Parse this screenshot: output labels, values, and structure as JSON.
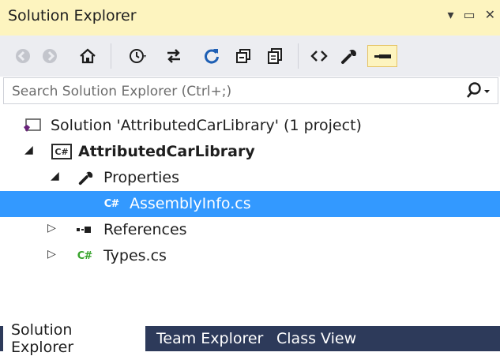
{
  "window": {
    "title": "Solution Explorer",
    "controls": [
      "dropdown-icon",
      "maximize-icon",
      "close-icon"
    ]
  },
  "toolbar": {
    "buttons": [
      {
        "name": "back-icon",
        "glyph": "⊝"
      },
      {
        "name": "forward-icon",
        "glyph": "⊝"
      },
      {
        "name": "home-icon",
        "glyph": "⌂"
      },
      {
        "name": "pending-changes-icon",
        "glyph": "⏲"
      },
      {
        "name": "sync-icon",
        "glyph": "⇆"
      },
      {
        "name": "refresh-icon",
        "glyph": "↻"
      },
      {
        "name": "collapse-all-icon",
        "glyph": "⧉"
      },
      {
        "name": "show-all-files-icon",
        "glyph": "⎘"
      },
      {
        "name": "view-code-icon",
        "glyph": "<>"
      },
      {
        "name": "properties-icon",
        "glyph": "🔧"
      },
      {
        "name": "preview-selected-icon",
        "glyph": "▬"
      }
    ],
    "dropdown_glyph": "▾"
  },
  "search": {
    "placeholder": "Search Solution Explorer (Ctrl+;)",
    "icon": "search-icon",
    "icon_glyph": "⚲",
    "dropdown_glyph": "▾"
  },
  "tree": {
    "solution_label": "Solution 'AttributedCarLibrary' (1 project)",
    "project_label": "AttributedCarLibrary",
    "project_badge": "C#",
    "properties_label": "Properties",
    "assemblyinfo_label": "AssemblyInfo.cs",
    "references_label": "References",
    "types_label": "Types.cs",
    "cs_badge": "C#",
    "expanded_glyph": "◢",
    "collapsed_glyph": "▷",
    "wrench_glyph": "🔧",
    "references_glyph": "▪▪"
  },
  "tabs": [
    {
      "label": "Solution Explorer",
      "active": true
    },
    {
      "label": "Team Explorer",
      "active": false
    },
    {
      "label": "Class View",
      "active": false
    }
  ],
  "colors": {
    "title_bar": "#fdf4bf",
    "selection": "#3399ff",
    "tab_bar": "#2d3a5a",
    "cs_green": "#37a32b"
  }
}
